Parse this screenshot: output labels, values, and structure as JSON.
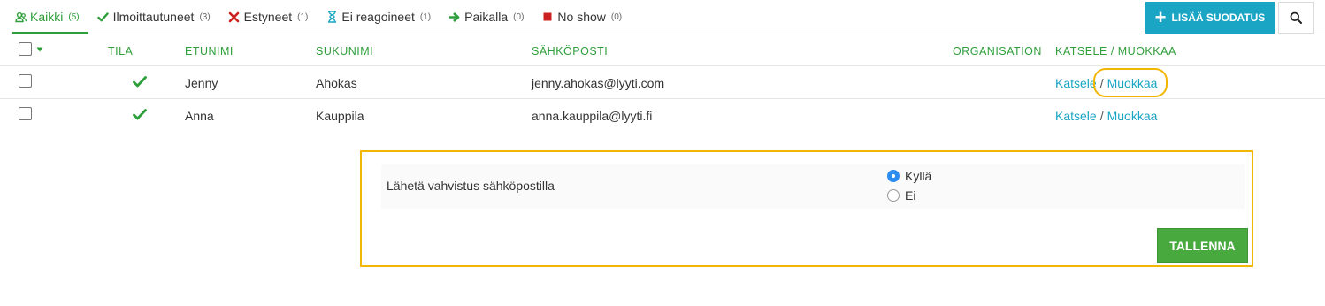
{
  "tabs": [
    {
      "label": "Kaikki",
      "count": "(5)",
      "icon": "users-icon",
      "color": "#2e9e3a"
    },
    {
      "label": "Ilmoittautuneet",
      "count": "(3)",
      "icon": "check-icon",
      "color": "#2e9e3a"
    },
    {
      "label": "Estyneet",
      "count": "(1)",
      "icon": "cross-icon",
      "color": "#cc1f1f"
    },
    {
      "label": "Ei reagoineet",
      "count": "(1)",
      "icon": "hourglass-icon",
      "color": "#1aa5c4"
    },
    {
      "label": "Paikalla",
      "count": "(0)",
      "icon": "arrow-right-icon",
      "color": "#2e9e3a"
    },
    {
      "label": "No show",
      "count": "(0)",
      "icon": "stop-square-icon",
      "color": "#cc1f1f"
    }
  ],
  "toolbar": {
    "add_filter_label": "LISÄÄ SUODATUS",
    "accent_color": "#1aa5c4"
  },
  "table": {
    "headers": {
      "status": "TILA",
      "first_name": "ETUNIMI",
      "last_name": "SUKUNIMI",
      "email": "SÄHKÖPOSTI",
      "organisation": "ORGANISATION",
      "actions": "KATSELE / MUOKKAA"
    },
    "rows": [
      {
        "status": "check",
        "first_name": "Jenny",
        "last_name": "Ahokas",
        "email": "jenny.ahokas@lyyti.com",
        "view": "Katsele",
        "sep": "/",
        "edit": "Muokkaa"
      },
      {
        "status": "check",
        "first_name": "Anna",
        "last_name": "Kauppila",
        "email": "anna.kauppila@lyyti.fi",
        "view": "Katsele",
        "sep": "/",
        "edit": "Muokkaa"
      }
    ]
  },
  "panel": {
    "label": "Lähetä vahvistus sähköpostilla",
    "options": [
      {
        "label": "Kyllä",
        "selected": true
      },
      {
        "label": "Ei",
        "selected": false
      }
    ],
    "save_label": "TALLENNA",
    "highlight_color": "#f2b705"
  }
}
